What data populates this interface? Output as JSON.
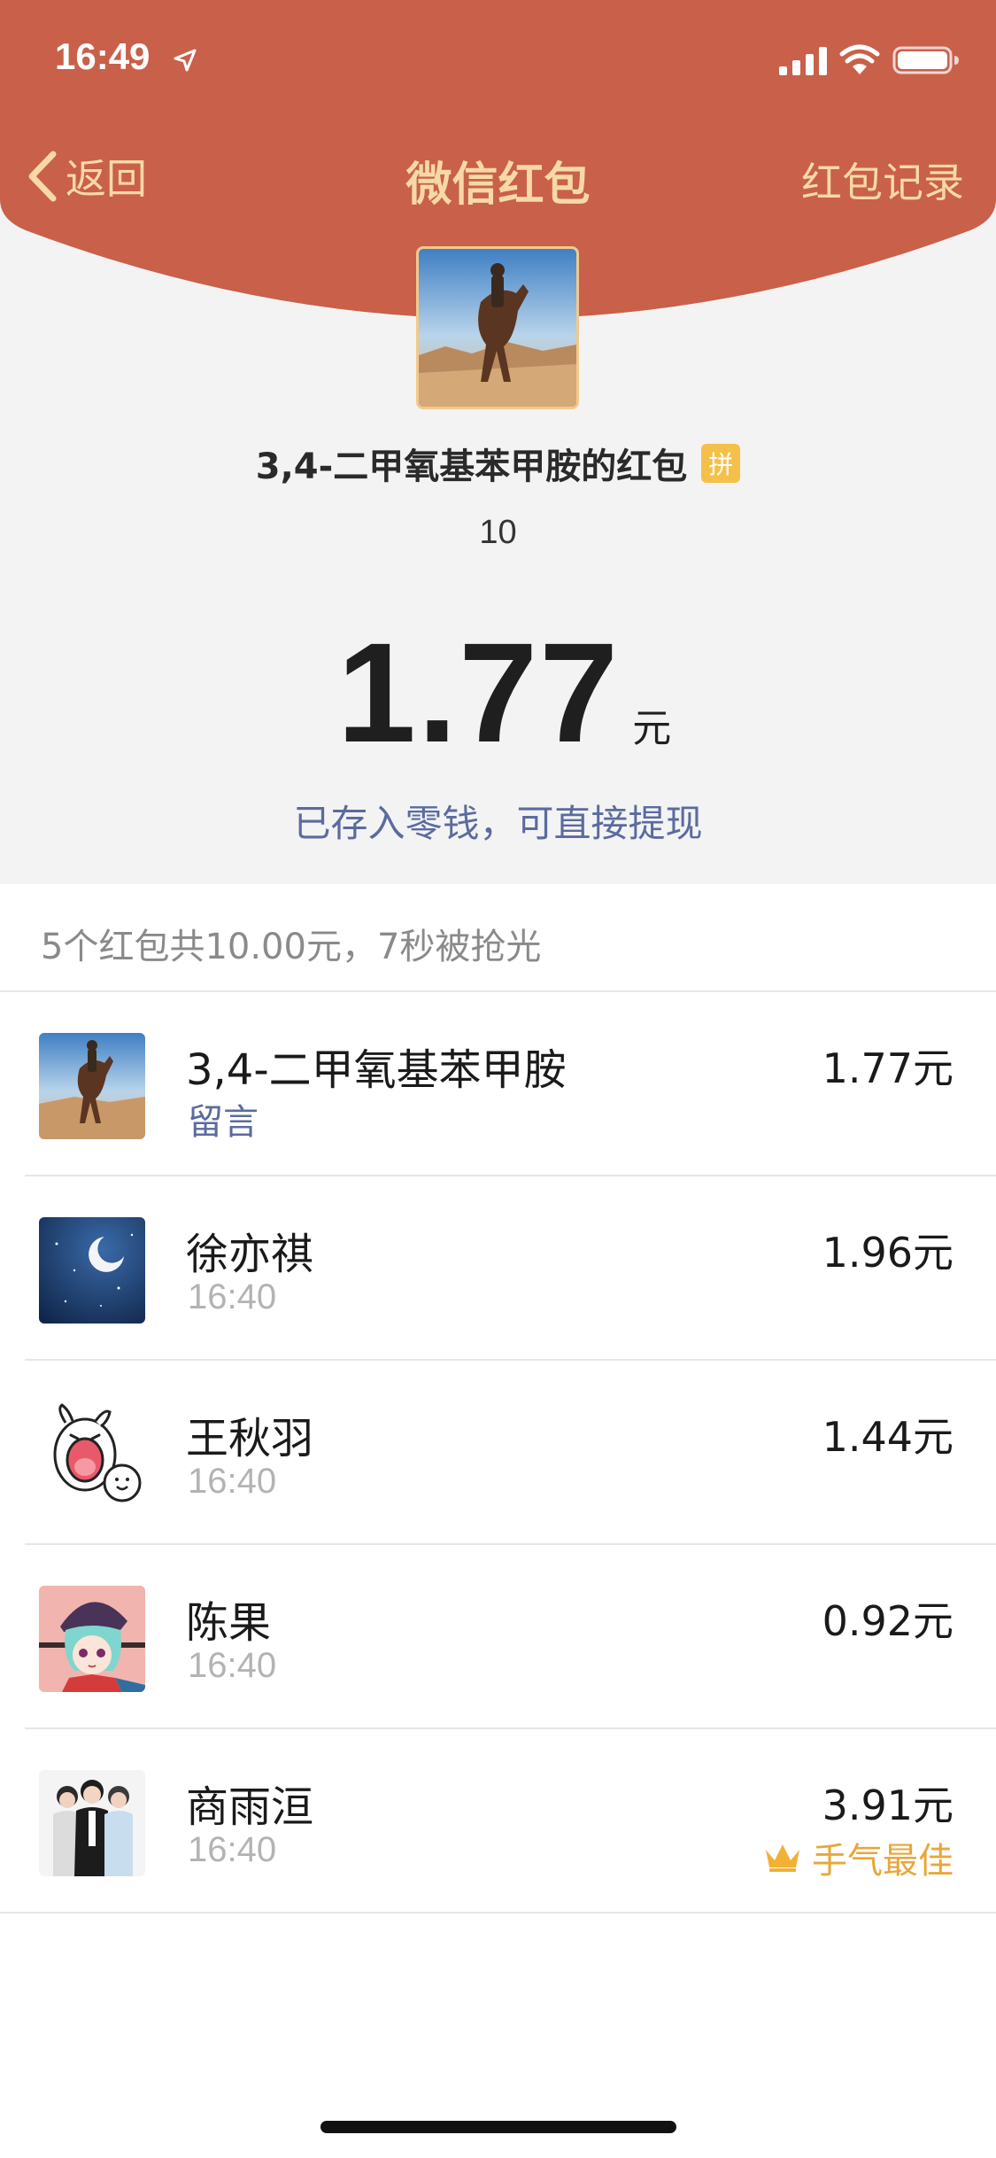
{
  "status_bar": {
    "time": "16:49",
    "icons": [
      "location-arrow-icon",
      "cellular-signal-icon",
      "wifi-icon",
      "battery-icon"
    ]
  },
  "nav": {
    "back_label": "返回",
    "title": "微信红包",
    "right_label": "红包记录"
  },
  "hero": {
    "sender_name": "3,4-二甲氧基苯甲胺的红包",
    "badge": "拼",
    "subtitle": "10",
    "amount": "1.77",
    "unit": "元",
    "link": "已存入零钱，可直接提现"
  },
  "summary": "5个红包共10.00元，7秒被抢光",
  "recipients": [
    {
      "name": "3,4-二甲氧基苯甲胺",
      "sub": "留言",
      "amount": "1.77元",
      "avatar": "horse-rider-avatar"
    },
    {
      "name": "徐亦祺",
      "sub": "16:40",
      "amount": "1.96元",
      "avatar": "night-moon-avatar"
    },
    {
      "name": "王秋羽",
      "sub": "16:40",
      "amount": "1.44元",
      "avatar": "cartoon-rabbit-avatar"
    },
    {
      "name": "陈果",
      "sub": "16:40",
      "amount": "0.92元",
      "avatar": "anime-girl-avatar"
    },
    {
      "name": "商雨洹",
      "sub": "16:40",
      "amount": "3.91元",
      "avatar": "group-photo-avatar",
      "best_label": "手气最佳"
    }
  ],
  "colors": {
    "header": "#c9604a",
    "nav_text": "#f6d9a6",
    "link": "#5b6b9e",
    "best": "#e8a73a"
  }
}
